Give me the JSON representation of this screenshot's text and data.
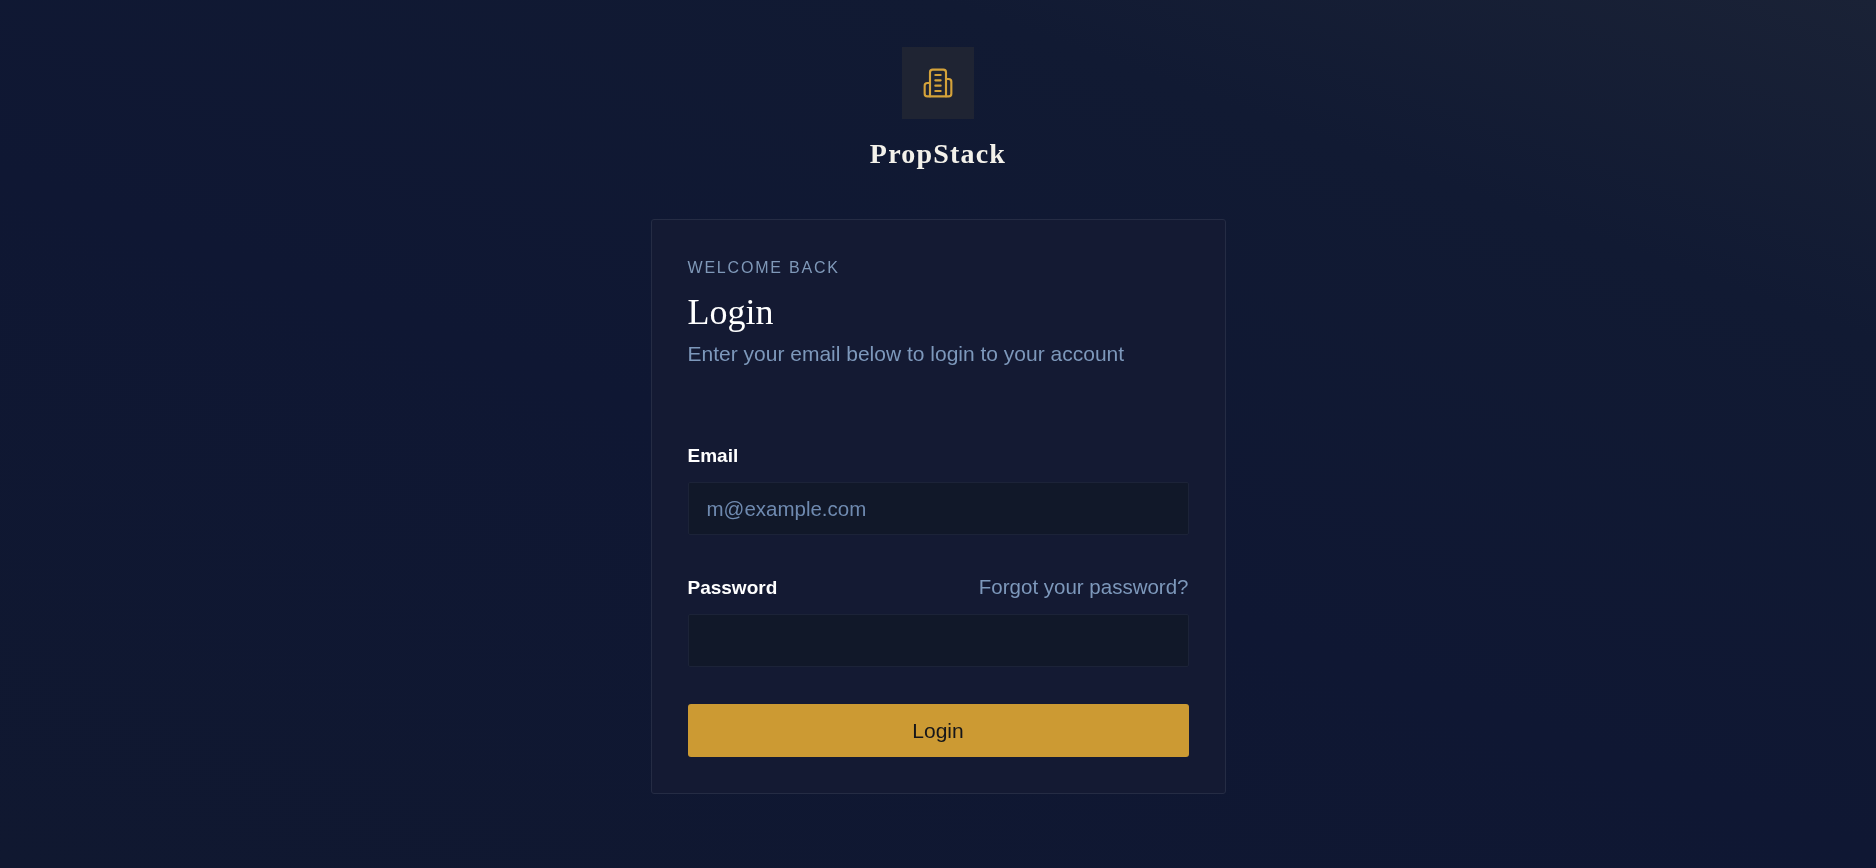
{
  "brand": {
    "name": "PropStack"
  },
  "card": {
    "eyebrow": "WELCOME BACK",
    "title": "Login",
    "subtitle": "Enter your email below to login to your account"
  },
  "fields": [
    {
      "label": "Email",
      "placeholder": "m@example.com"
    },
    {
      "label": "Password",
      "link": "Forgot your password?"
    }
  ],
  "submit": {
    "label": "Login"
  }
}
